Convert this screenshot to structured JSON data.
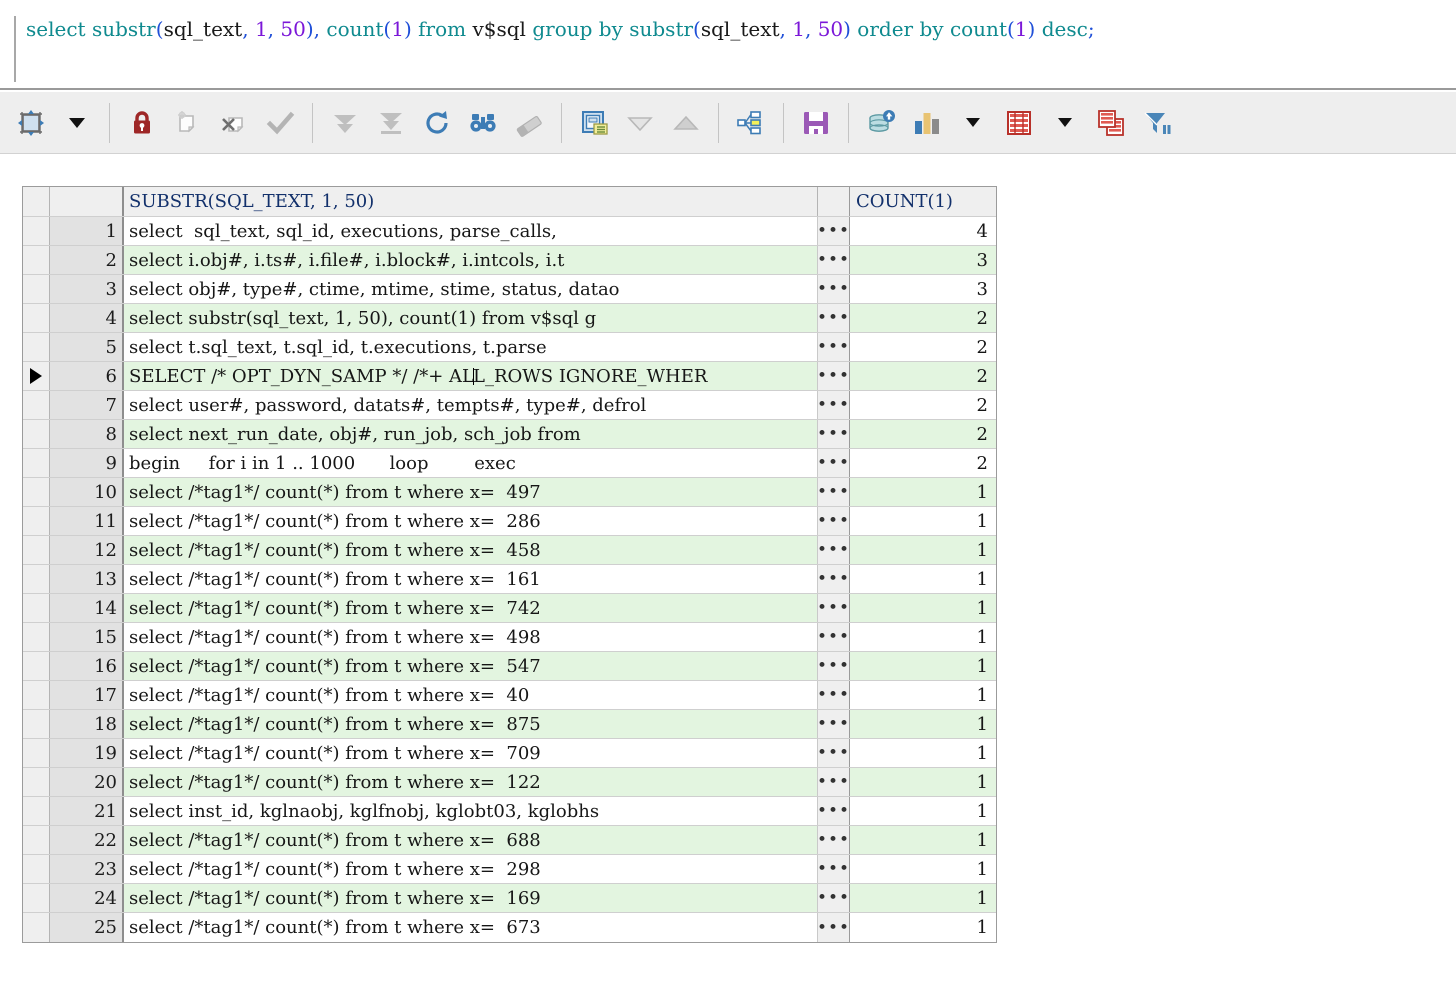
{
  "editor": {
    "sql_tokens": [
      {
        "t": "select ",
        "c": "kw"
      },
      {
        "t": "substr",
        "c": "kw"
      },
      {
        "t": "(",
        "c": "pun"
      },
      {
        "t": "sql_text",
        "c": "idn"
      },
      {
        "t": ", ",
        "c": "pun"
      },
      {
        "t": "1",
        "c": "num"
      },
      {
        "t": ", ",
        "c": "pun"
      },
      {
        "t": "50",
        "c": "num"
      },
      {
        "t": ")",
        "c": "pun"
      },
      {
        "t": ", ",
        "c": "pun"
      },
      {
        "t": "count",
        "c": "kw"
      },
      {
        "t": "(",
        "c": "pun"
      },
      {
        "t": "1",
        "c": "num"
      },
      {
        "t": ")",
        "c": "pun"
      },
      {
        "t": " from ",
        "c": "kw"
      },
      {
        "t": "v$sql",
        "c": "idn"
      },
      {
        "t": " group by ",
        "c": "kw"
      },
      {
        "t": "substr",
        "c": "kw"
      },
      {
        "t": "(",
        "c": "pun"
      },
      {
        "t": "sql_text",
        "c": "idn"
      },
      {
        "t": ", ",
        "c": "pun"
      },
      {
        "t": "1",
        "c": "num"
      },
      {
        "t": ", ",
        "c": "pun"
      },
      {
        "t": "50",
        "c": "num"
      },
      {
        "t": ")",
        "c": "pun"
      },
      {
        "t": " order by ",
        "c": "kw"
      },
      {
        "t": "count",
        "c": "kw"
      },
      {
        "t": "(",
        "c": "pun"
      },
      {
        "t": "1",
        "c": "num"
      },
      {
        "t": ")",
        "c": "pun"
      },
      {
        "t": " desc",
        "c": "kw"
      },
      {
        "t": ";",
        "c": "pun"
      }
    ],
    "sql_plain": "select substr(sql_text, 1, 50), count(1) from v$sql group by substr(sql_text, 1, 50) order by count(1) desc;"
  },
  "toolbar": {
    "items": [
      {
        "name": "grid-layout-button",
        "icon": "grid-layout-icon",
        "has_caret": true,
        "tooltip": "Grid layout"
      },
      {
        "name": "lock-record-button",
        "icon": "padlock-icon",
        "tooltip": "Lock record"
      },
      {
        "name": "insert-record-button",
        "icon": "new-record-icon",
        "tooltip": "Insert record"
      },
      {
        "name": "delete-record-button",
        "icon": "delete-record-icon",
        "tooltip": "Delete record"
      },
      {
        "name": "post-changes-button",
        "icon": "checkmark-icon",
        "tooltip": "Post changes"
      },
      {
        "name": "fetch-next-page-button",
        "icon": "double-down-arrow-icon",
        "tooltip": "Fetch next page"
      },
      {
        "name": "fetch-last-page-button",
        "icon": "arrow-to-bar-icon",
        "tooltip": "Fetch last page"
      },
      {
        "name": "refresh-button",
        "icon": "refresh-icon",
        "tooltip": "Refresh"
      },
      {
        "name": "find-button",
        "icon": "binoculars-icon",
        "tooltip": "Find"
      },
      {
        "name": "clear-button",
        "icon": "eraser-icon",
        "tooltip": "Clear"
      },
      {
        "name": "single-record-view-button",
        "icon": "form-view-icon",
        "tooltip": "Single record view"
      },
      {
        "name": "previous-record-button",
        "icon": "triangle-down-icon",
        "tooltip": "Next record"
      },
      {
        "name": "next-record-button",
        "icon": "triangle-up-icon",
        "tooltip": "Previous record"
      },
      {
        "name": "structure-button",
        "icon": "hierarchy-tree-icon",
        "tooltip": "Structure"
      },
      {
        "name": "save-button",
        "icon": "floppy-disk-icon",
        "tooltip": "Save"
      },
      {
        "name": "export-data-button",
        "icon": "database-upload-icon",
        "tooltip": "Export data"
      },
      {
        "name": "chart-button",
        "icon": "bar-chart-icon",
        "has_caret": true,
        "tooltip": "Chart"
      },
      {
        "name": "grid-button",
        "icon": "red-grid-icon",
        "has_caret": true,
        "tooltip": "Grid"
      },
      {
        "name": "duplicate-grid-button",
        "icon": "copy-grid-icon",
        "tooltip": "Duplicate grid"
      },
      {
        "name": "filter-button",
        "icon": "funnel-filter-icon",
        "tooltip": "Filter"
      }
    ]
  },
  "grid": {
    "columns": [
      {
        "key": "text",
        "label": "SUBSTR(SQL_TEXT, 1, 50)"
      },
      {
        "key": "count",
        "label": "COUNT(1)"
      }
    ],
    "ellipsis": "•••",
    "selected_row": 6,
    "rows": [
      {
        "n": "1",
        "text": "select  sql_text, sql_id, executions, parse_calls,",
        "count": "4"
      },
      {
        "n": "2",
        "text": "select i.obj#, i.ts#, i.file#, i.block#, i.intcols, i.t",
        "count": "3"
      },
      {
        "n": "3",
        "text": "select obj#, type#, ctime, mtime, stime, status, datao",
        "count": "3"
      },
      {
        "n": "4",
        "text": "select substr(sql_text, 1, 50), count(1) from v$sql g",
        "count": "2"
      },
      {
        "n": "5",
        "text": "select t.sql_text, t.sql_id, t.executions, t.parse",
        "count": "2"
      },
      {
        "n": "6",
        "text": "SELECT /* OPT_DYN_SAMP */ /*+ ALL_ROWS IGNORE_WHER",
        "count": "2"
      },
      {
        "n": "7",
        "text": "select user#, password, datats#, tempts#, type#, defrol",
        "count": "2"
      },
      {
        "n": "8",
        "text": "select next_run_date, obj#, run_job, sch_job from",
        "count": "2"
      },
      {
        "n": "9",
        "text": "begin     for i in 1 .. 1000      loop        exec",
        "count": "2"
      },
      {
        "n": "10",
        "text": "select /*tag1*/ count(*) from t where x=  497",
        "count": "1"
      },
      {
        "n": "11",
        "text": "select /*tag1*/ count(*) from t where x=  286",
        "count": "1"
      },
      {
        "n": "12",
        "text": "select /*tag1*/ count(*) from t where x=  458",
        "count": "1"
      },
      {
        "n": "13",
        "text": "select /*tag1*/ count(*) from t where x=  161",
        "count": "1"
      },
      {
        "n": "14",
        "text": "select /*tag1*/ count(*) from t where x=  742",
        "count": "1"
      },
      {
        "n": "15",
        "text": "select /*tag1*/ count(*) from t where x=  498",
        "count": "1"
      },
      {
        "n": "16",
        "text": "select /*tag1*/ count(*) from t where x=  547",
        "count": "1"
      },
      {
        "n": "17",
        "text": "select /*tag1*/ count(*) from t where x=  40",
        "count": "1"
      },
      {
        "n": "18",
        "text": "select /*tag1*/ count(*) from t where x=  875",
        "count": "1"
      },
      {
        "n": "19",
        "text": "select /*tag1*/ count(*) from t where x=  709",
        "count": "1"
      },
      {
        "n": "20",
        "text": "select /*tag1*/ count(*) from t where x=  122",
        "count": "1"
      },
      {
        "n": "21",
        "text": "select inst_id, kglnaobj, kglfnobj, kglobt03, kglobhs",
        "count": "1"
      },
      {
        "n": "22",
        "text": "select /*tag1*/ count(*) from t where x=  688",
        "count": "1"
      },
      {
        "n": "23",
        "text": "select /*tag1*/ count(*) from t where x=  298",
        "count": "1"
      },
      {
        "n": "24",
        "text": "select /*tag1*/ count(*) from t where x=  169",
        "count": "1"
      },
      {
        "n": "25",
        "text": "select /*tag1*/ count(*) from t where x=  673",
        "count": "1"
      }
    ]
  },
  "colors": {
    "keyword": "#0f8a8f",
    "number": "#7b17d8",
    "punctuation": "#1f4fd8",
    "header_text": "#12306b",
    "alt_row_bg": "#e3f5e0",
    "toolbar_bg": "#eeeeee",
    "lock_red": "#9e2727",
    "save_purple": "#9b59b6",
    "grid_red": "#c0392b",
    "accent_blue": "#3d7cb5"
  }
}
